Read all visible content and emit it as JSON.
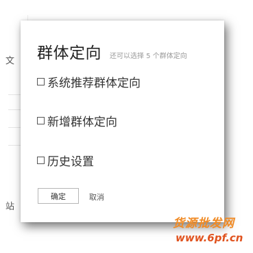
{
  "background": {
    "glyph_top": "文",
    "glyph_bottom": "站"
  },
  "dialog": {
    "title": "群体定向",
    "hint": "还可以选择 5 个群体定向",
    "options": [
      {
        "label": "系统推荐群体定向",
        "checked": false
      },
      {
        "label": "新增群体定向",
        "checked": false
      },
      {
        "label": "历史设置",
        "checked": false
      }
    ],
    "confirm_label": "确定",
    "cancel_label": "取消"
  },
  "watermark": {
    "text": "货源批发网",
    "url": "www.6pf.cn"
  },
  "colors": {
    "title": "#222222",
    "hint": "#999999",
    "watermark_primary": "#f08a24",
    "watermark_url": "#e0531f"
  }
}
